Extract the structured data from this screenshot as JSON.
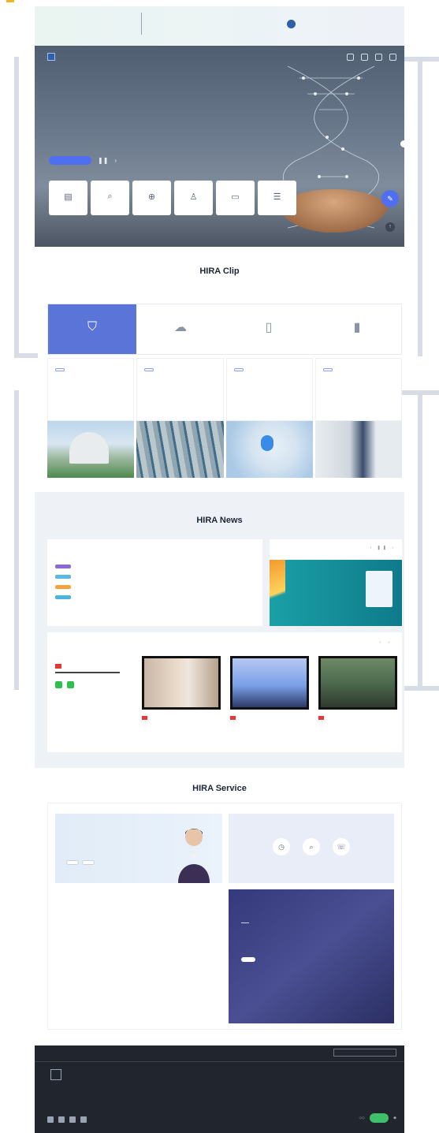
{
  "notice": {
    "left_text": "",
    "title": "",
    "subtitle": "",
    "right_text": ""
  },
  "hero": {
    "logo_text": "",
    "heading_line1": "",
    "heading_line2": "",
    "slide_button": "",
    "quick_links": [
      {
        "icon": "document-icon",
        "label": ""
      },
      {
        "icon": "search-icon",
        "label": ""
      },
      {
        "icon": "hospital-icon",
        "label": ""
      },
      {
        "icon": "person-icon",
        "label": ""
      },
      {
        "icon": "folder-icon",
        "label": ""
      },
      {
        "icon": "list-icon",
        "label": ""
      }
    ]
  },
  "clip": {
    "title": "HIRA Clip",
    "subtitle": "",
    "tabs": [
      {
        "icon": "shield-icon",
        "label": ""
      },
      {
        "icon": "cloud-icon",
        "label": ""
      },
      {
        "icon": "document-icon",
        "label": ""
      },
      {
        "icon": "phone-icon",
        "label": ""
      }
    ],
    "cards": [
      {
        "tag": "",
        "title": "",
        "desc": ""
      },
      {
        "tag": "",
        "title": "",
        "desc": ""
      },
      {
        "tag": "",
        "title": "",
        "desc": ""
      },
      {
        "tag": "",
        "title": "",
        "desc": ""
      }
    ]
  },
  "news": {
    "title": "HIRA News",
    "tabs": [
      "",
      "",
      "",
      "",
      ""
    ],
    "rows": [
      {
        "tag_color": "#8a6ad8",
        "text": "",
        "date": ""
      },
      {
        "tag_color": "#5bb8e0",
        "text": "",
        "date": ""
      },
      {
        "tag_color": "#f2a63a",
        "text": "",
        "date": ""
      },
      {
        "tag_color": "#4bb3d9",
        "text": "",
        "date": ""
      }
    ],
    "promo": {
      "heading": "",
      "banner_text": ""
    },
    "video": {
      "heading": "",
      "side_text": "",
      "items": [
        {
          "caption": ""
        },
        {
          "caption": ""
        },
        {
          "caption": ""
        }
      ]
    }
  },
  "service": {
    "title": "HIRA Service",
    "panel_a_text": "",
    "panel_a_buttons": [
      "",
      ""
    ],
    "panel_b_items": [
      {
        "icon": "clock-icon",
        "label": ""
      },
      {
        "icon": "search-icon",
        "label": ""
      },
      {
        "icon": "chat-icon",
        "label": ""
      }
    ],
    "list_heading": "",
    "list_items": [
      "",
      "",
      "",
      "",
      "",
      ""
    ],
    "panel_d_heading": "",
    "panel_d_text": "",
    "panel_d_button": ""
  },
  "footer": {
    "links": [
      "",
      "",
      "",
      "",
      "",
      "",
      "",
      ""
    ],
    "select": "",
    "address": "",
    "phone": "",
    "copyright": ""
  },
  "colors": {
    "accent": "#4f6ff0",
    "clip_active": "#5b74d8",
    "footer_bg": "#21262e"
  }
}
